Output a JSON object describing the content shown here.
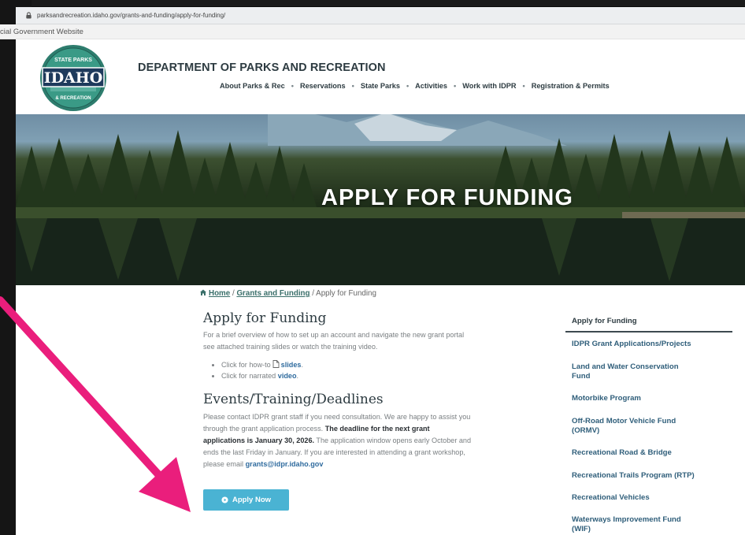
{
  "browser": {
    "url": "parksandrecreation.idaho.gov/grants-and-funding/apply-for-funding/"
  },
  "gov_banner": {
    "text": "cial Government Website"
  },
  "header": {
    "logo_top": "STATE PARKS",
    "logo_main": "IDAHO",
    "logo_bottom": "& RECREATION",
    "department_title": "DEPARTMENT OF PARKS AND RECREATION",
    "nav": [
      {
        "label": "About Parks & Rec"
      },
      {
        "label": "Reservations"
      },
      {
        "label": "State Parks"
      },
      {
        "label": "Activities"
      },
      {
        "label": "Work with IDPR"
      },
      {
        "label": "Registration & Permits"
      }
    ],
    "nav_separator": "•"
  },
  "hero": {
    "title": "APPLY FOR FUNDING"
  },
  "breadcrumb": {
    "home": "Home",
    "sep1": "/",
    "grants": "Grants and Funding",
    "sep2": "/",
    "current": "Apply for Funding"
  },
  "main": {
    "heading1": "Apply for Funding",
    "intro_line1": "For a brief overview of how to set up an account and navigate the new grant portal",
    "intro_line2": "see attached training slides or watch the training video.",
    "bullets": [
      {
        "prefix": "Click for how-to",
        "link": "slides",
        "suffix": "."
      },
      {
        "prefix": "Click for narrated",
        "link": "video",
        "suffix": "."
      }
    ],
    "heading2": "Events/Training/Deadlines",
    "p2_line1": "Please contact IDPR grant staff if you need consultation. We are happy to assist you",
    "p2_line2_a": "through the grant application process.",
    "p2_line2_b": "The deadline for the next grant",
    "p2_line3_b": "applications is January 30, 2026.",
    "p2_line3_a": "The application window opens early October and",
    "p2_line4": "ends the last Friday in January. If you are interested in attending a grant workshop,",
    "p2_line5_a": "please email",
    "p2_email": "grants@idpr.idaho.gov",
    "apply_button": "Apply Now"
  },
  "sidebar": {
    "items": [
      {
        "label": "Apply for Funding",
        "active": true
      },
      {
        "label": "IDPR Grant Applications/Projects"
      },
      {
        "label": "Land and Water Conservation",
        "label2": "Fund"
      },
      {
        "label": "Motorbike Program"
      },
      {
        "label": "Off-Road Motor Vehicle Fund",
        "label2": "(ORMV)"
      },
      {
        "label": "Recreational Road & Bridge"
      },
      {
        "label": "Recreational Trails Program (RTP)"
      },
      {
        "label": "Recreational Vehicles"
      },
      {
        "label": "Waterways Improvement Fund",
        "label2": "(WIF)"
      }
    ]
  },
  "colors": {
    "annotation_arrow": "#ea1e7c",
    "button": "#4ab3d3",
    "link": "#2f6b9e"
  }
}
